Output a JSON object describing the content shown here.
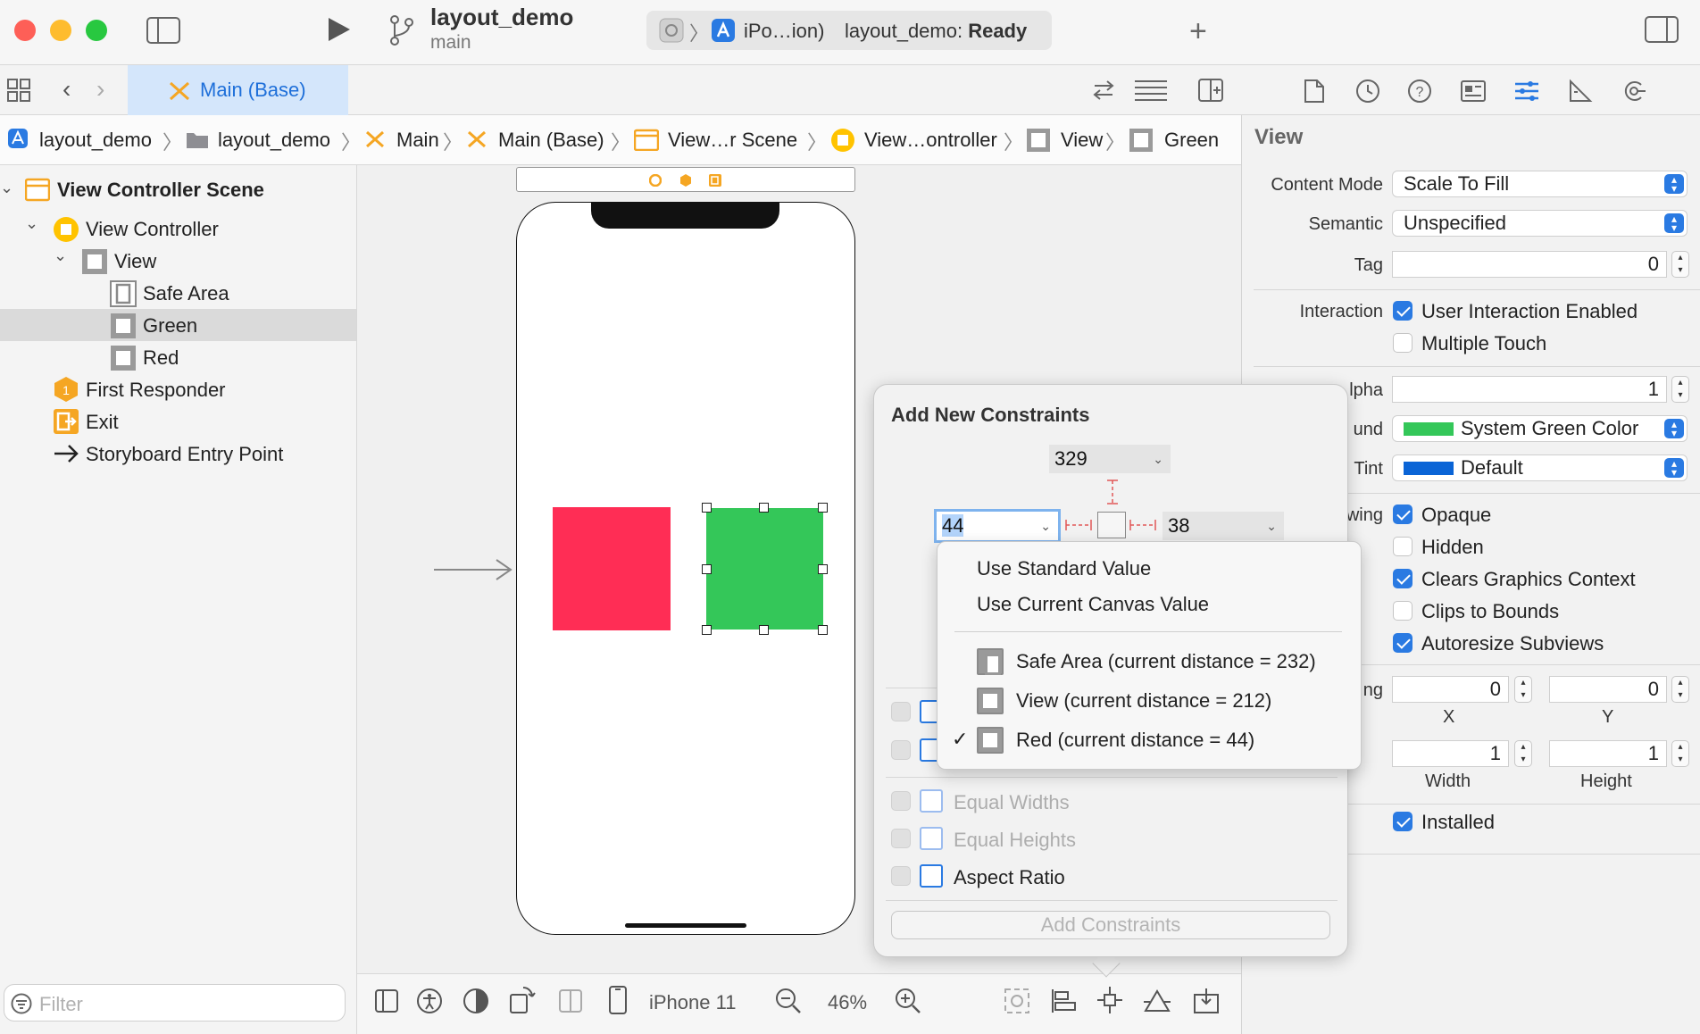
{
  "window": {
    "project_title": "layout_demo",
    "branch": "main",
    "scheme_destination": "iPo…ion)",
    "status_prefix": "layout_demo: ",
    "status_value": "Ready"
  },
  "tab": {
    "label": "Main (Base)"
  },
  "breadcrumb": [
    "layout_demo",
    "layout_demo",
    "Main",
    "Main (Base)",
    "View…r Scene",
    "View…ontroller",
    "View",
    "Green"
  ],
  "navigator": {
    "items": [
      "View Controller Scene",
      "View Controller",
      "View",
      "Safe Area",
      "Green",
      "Red",
      "First Responder",
      "Exit",
      "Storyboard Entry Point"
    ],
    "filter_placeholder": "Filter"
  },
  "canvas": {
    "device": "iPhone 11",
    "zoom": "46%",
    "colors": {
      "red_view": "#ff2d55",
      "green_view": "#34c759"
    }
  },
  "constraints_popover": {
    "title": "Add New Constraints",
    "top_value": "329",
    "left_value": "44",
    "right_value": "38",
    "rows": [
      {
        "label": "Equal Widths",
        "enabled": false
      },
      {
        "label": "Equal Heights",
        "enabled": false
      },
      {
        "label": "Aspect Ratio",
        "enabled": true
      }
    ],
    "add_button": "Add Constraints"
  },
  "dropdown_menu": {
    "standard": "Use Standard Value",
    "canvas": "Use Current Canvas Value",
    "options": [
      {
        "label": "Safe Area (current distance = 232)",
        "checked": false
      },
      {
        "label": "View (current distance = 212)",
        "checked": false
      },
      {
        "label": "Red (current distance = 44)",
        "checked": true
      }
    ],
    "checkmark": "✓"
  },
  "inspector": {
    "heading": "View",
    "content_mode_label": "Content Mode",
    "content_mode": "Scale To Fill",
    "semantic_label": "Semantic",
    "semantic": "Unspecified",
    "tag_label": "Tag",
    "tag": "0",
    "interaction_label": "Interaction",
    "user_interaction": "User Interaction Enabled",
    "multiple_touch": "Multiple Touch",
    "alpha_label": "lpha",
    "alpha": "1",
    "background_label": "und",
    "background": "System Green Color",
    "tint_label": "Tint",
    "tint": "Default",
    "drawing_label": "wing",
    "opaque": "Opaque",
    "hidden": "Hidden",
    "clears_graphics": "Clears Graphics Context",
    "clips_to_bounds": "Clips to Bounds",
    "autoresize": "Autoresize Subviews",
    "stretching_label": "ng",
    "x_value": "0",
    "y_value": "0",
    "x_label": "X",
    "y_label": "Y",
    "width_value": "1",
    "height_value": "1",
    "width_label": "Width",
    "height_label": "Height",
    "installed": "Installed",
    "colors": {
      "background_swatch": "#34c759",
      "tint_swatch": "#0a64d6"
    }
  }
}
